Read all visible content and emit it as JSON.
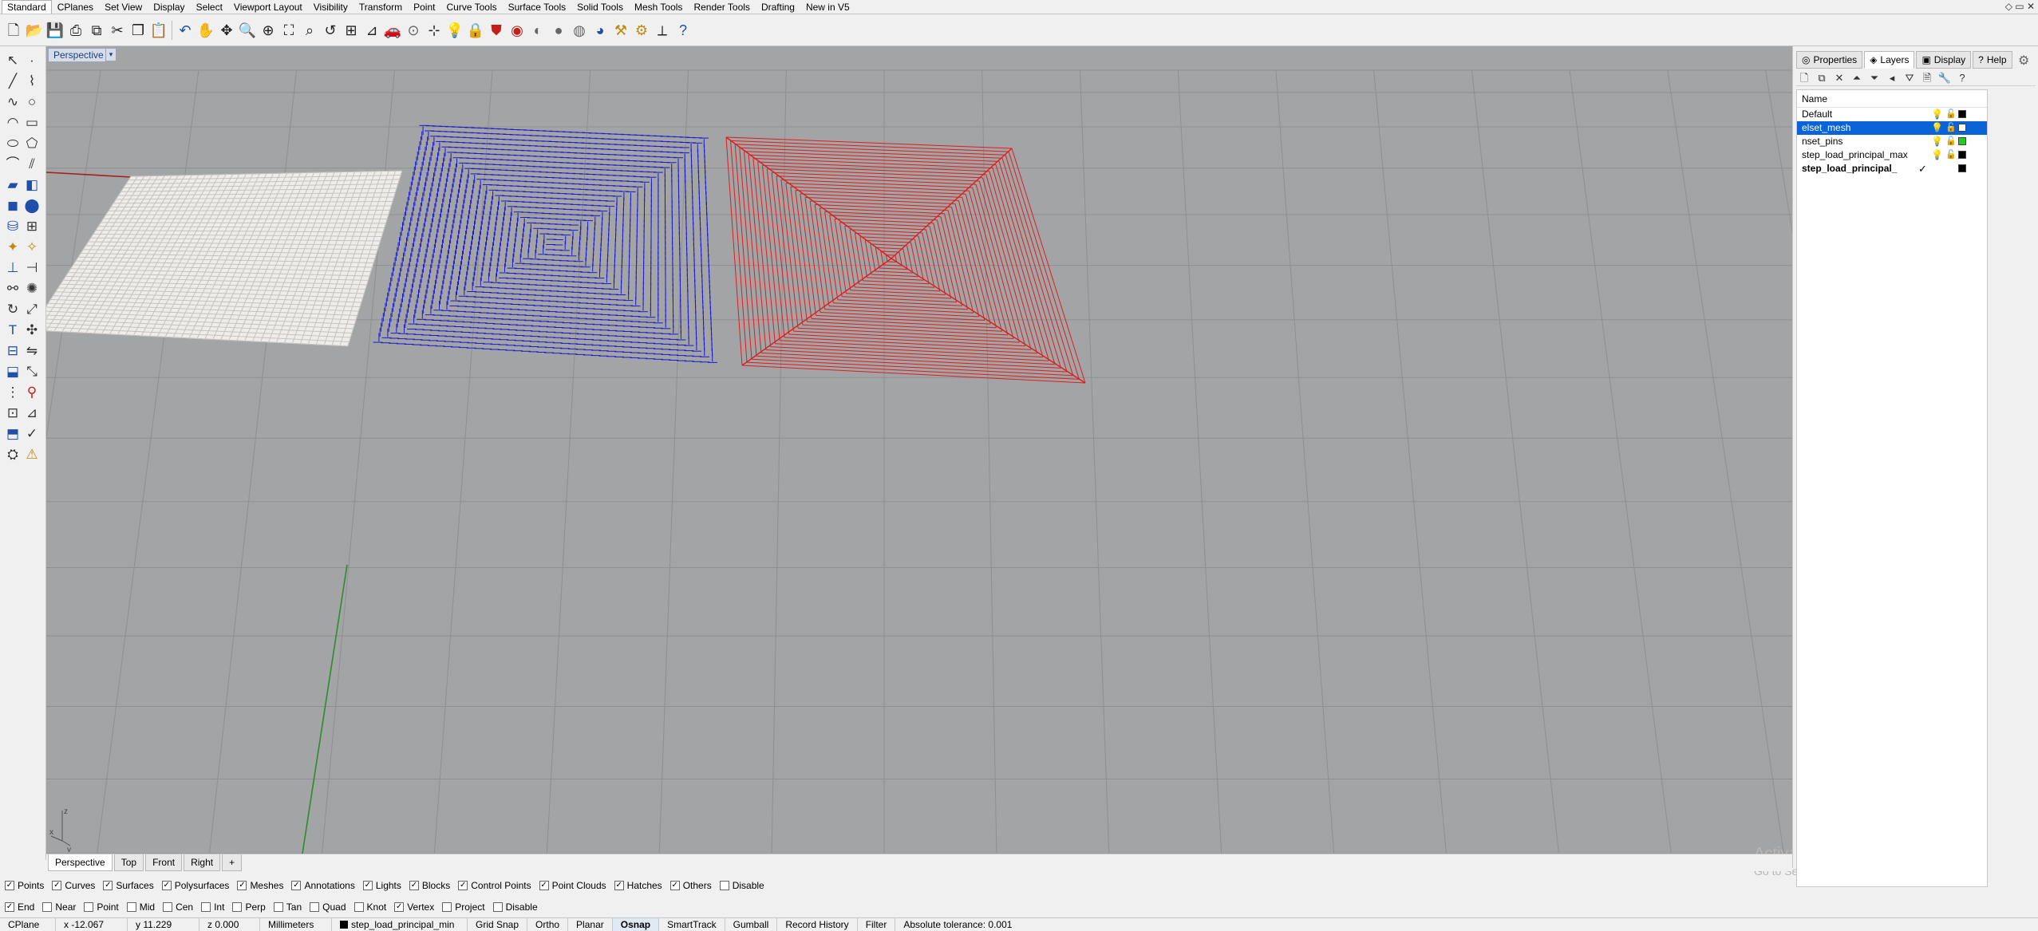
{
  "toolbar_tabs": [
    "Standard",
    "CPlanes",
    "Set View",
    "Display",
    "Select",
    "Viewport Layout",
    "Visibility",
    "Transform",
    "Point",
    "Curve Tools",
    "Surface Tools",
    "Solid Tools",
    "Mesh Tools",
    "Render Tools",
    "Drafting",
    "New in V5"
  ],
  "window_controls": "◇ ▭ ✕",
  "viewport": {
    "label": "Perspective",
    "dropdown": "▾",
    "axis_x": "x",
    "axis_y": "y",
    "axis_z": "z"
  },
  "watermark": {
    "title": "Activate Windows",
    "subtitle": "Go to Settings to activate Windows."
  },
  "viewport_tabs": [
    "Perspective",
    "Top",
    "Front",
    "Right",
    "+"
  ],
  "panel": {
    "tabs": [
      {
        "label": "Properties",
        "icon": "properties-icon"
      },
      {
        "label": "Layers",
        "icon": "layers-icon"
      },
      {
        "label": "Display",
        "icon": "display-icon"
      },
      {
        "label": "Help",
        "icon": "help-icon"
      }
    ],
    "column_name": "Name",
    "layers": [
      {
        "name": "Default",
        "color": "#000000",
        "selected": false,
        "current": false
      },
      {
        "name": "elset_mesh",
        "color": "#ffffff",
        "selected": true,
        "current": false
      },
      {
        "name": "nset_pins",
        "color": "#22cc22",
        "selected": false,
        "current": false
      },
      {
        "name": "step_load_principal_max",
        "color": "#000000",
        "selected": false,
        "current": false
      },
      {
        "name": "step_load_principal_",
        "color": "#000000",
        "selected": false,
        "current": true
      }
    ],
    "current_mark": "✓"
  },
  "filters": [
    {
      "label": "Points",
      "checked": true
    },
    {
      "label": "Curves",
      "checked": true
    },
    {
      "label": "Surfaces",
      "checked": true
    },
    {
      "label": "Polysurfaces",
      "checked": true
    },
    {
      "label": "Meshes",
      "checked": true
    },
    {
      "label": "Annotations",
      "checked": true
    },
    {
      "label": "Lights",
      "checked": true
    },
    {
      "label": "Blocks",
      "checked": true
    },
    {
      "label": "Control Points",
      "checked": true
    },
    {
      "label": "Point Clouds",
      "checked": true
    },
    {
      "label": "Hatches",
      "checked": true
    },
    {
      "label": "Others",
      "checked": true
    },
    {
      "label": "Disable",
      "checked": false
    }
  ],
  "osnaps": [
    {
      "label": "End",
      "checked": true
    },
    {
      "label": "Near",
      "checked": false
    },
    {
      "label": "Point",
      "checked": false
    },
    {
      "label": "Mid",
      "checked": false
    },
    {
      "label": "Cen",
      "checked": false
    },
    {
      "label": "Int",
      "checked": false
    },
    {
      "label": "Perp",
      "checked": false
    },
    {
      "label": "Tan",
      "checked": false
    },
    {
      "label": "Quad",
      "checked": false
    },
    {
      "label": "Knot",
      "checked": false
    },
    {
      "label": "Vertex",
      "checked": true
    },
    {
      "label": "Project",
      "checked": false
    },
    {
      "label": "Disable",
      "checked": false
    }
  ],
  "status": {
    "cplane": "CPlane",
    "x": "x -12.067",
    "y": "y 11.229",
    "z": "z 0.000",
    "units": "Millimeters",
    "layer": "step_load_principal_min",
    "grid_snap": "Grid Snap",
    "ortho": "Ortho",
    "planar": "Planar",
    "osnap": "Osnap",
    "smarttrack": "SmartTrack",
    "gumball": "Gumball",
    "record_history": "Record History",
    "filter": "Filter",
    "tolerance": "Absolute tolerance: 0.001"
  },
  "colors": {
    "blue_vectors": "#1a1ad0",
    "red_vectors": "#dd1e1e",
    "mesh_fill": "#eeedea",
    "viewport_bg": "#a3a4a5",
    "selection": "#0a64d8"
  }
}
